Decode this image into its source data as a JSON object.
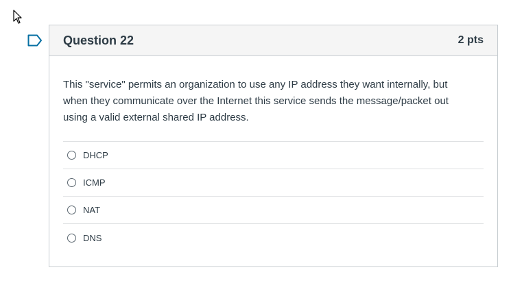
{
  "question": {
    "title": "Question 22",
    "points": "2 pts",
    "text": "This \"service\" permits an organization to use any IP address they want internally, but when they communicate over the Internet this service sends the message/packet out using a valid external shared IP address.",
    "answers": [
      {
        "label": "DHCP"
      },
      {
        "label": "ICMP"
      },
      {
        "label": "NAT"
      },
      {
        "label": "DNS"
      }
    ]
  },
  "icons": {
    "cursor": "mouse-pointer-icon",
    "flag": "bookmark-flag-icon"
  },
  "colors": {
    "text": "#2d3b45",
    "header_bg": "#f5f5f5",
    "border": "#c7cdd1",
    "flag": "#0770a3"
  }
}
